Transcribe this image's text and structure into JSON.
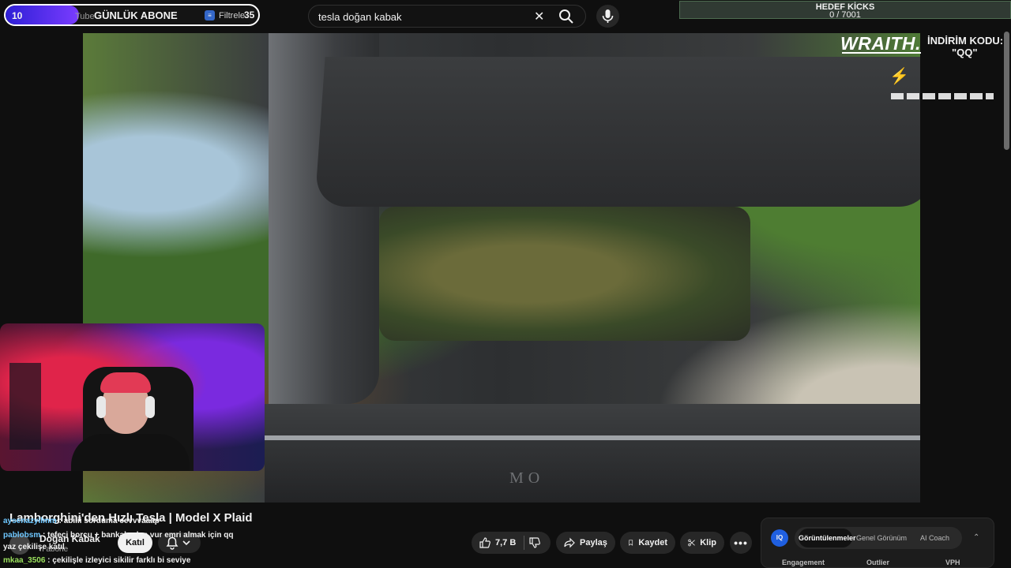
{
  "subscriber_goal": {
    "count": "10",
    "label": "GÜNLÜK ABONE",
    "logo_text": "Tube",
    "filter_label": "Filtrele",
    "goal": "35",
    "progress_fraction": 0.29
  },
  "search": {
    "query": "tesla doğan kabak"
  },
  "kicks_goal": {
    "title": "HEDEF KİCKS",
    "progress": "0 / 7001"
  },
  "sponsor": {
    "brand": "WRAITH.",
    "code_line1": "İNDİRİM KODU:",
    "code_line2": "\"QQ\""
  },
  "video": {
    "brand_text": "MO",
    "title": "Lamborghini'den Hızlı Tesla | Model X Plaid"
  },
  "channel": {
    "name": "Doğan Kabak",
    "subs": "n abone",
    "join_label": "Katıl"
  },
  "actions": {
    "likes": "7,7 B",
    "share": "Paylaş",
    "save": "Kaydet",
    "clip": "Klip"
  },
  "chat": [
    {
      "user": "aysenazyilmm",
      "text": ": abiiii sorduma cevvvaaap"
    },
    {
      "user": "pablobsm",
      "text": ": tefeci borcu + bankalardan vur emri almak için qq"
    },
    {
      "user": "",
      "text": "yaz çekilişe katıl"
    },
    {
      "user": "mkaa_3506",
      "text": ": çekilişle izleyici sikilir farklı bi seviye"
    }
  ],
  "analytics": {
    "logo": "IQ",
    "tabs": [
      "Görüntülenmeler",
      "Genel Görünüm",
      "AI Coach"
    ],
    "columns": [
      "Engagement",
      "Outlier",
      "VPH"
    ]
  }
}
